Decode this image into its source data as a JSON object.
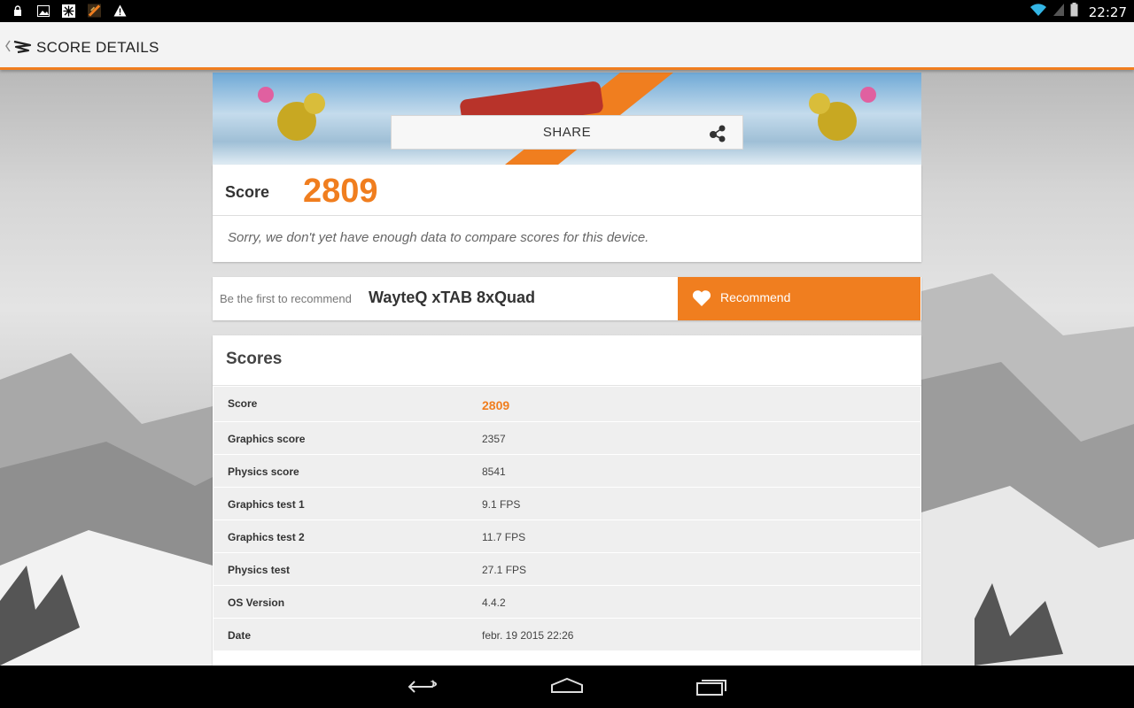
{
  "status_bar": {
    "time": "22:27",
    "left_icons": [
      "lock-icon",
      "gallery-icon",
      "snowflake-icon",
      "game-notification-icon",
      "warning-icon"
    ],
    "right_icons": [
      "wifi-icon",
      "signal-icon",
      "battery-icon"
    ]
  },
  "action_bar": {
    "title": "SCORE DETAILS"
  },
  "banner": {
    "share_label": "SHARE"
  },
  "score_card": {
    "label": "Score",
    "value": "2809",
    "note": "Sorry, we don't yet have enough data to compare scores for this device."
  },
  "recommend": {
    "prefix": "Be the first to recommend",
    "device": "WayteQ xTAB 8xQuad",
    "button_label": "Recommend"
  },
  "scores": {
    "title": "Scores",
    "rows": [
      {
        "name": "Score",
        "value": "2809"
      },
      {
        "name": "Graphics score",
        "value": "2357"
      },
      {
        "name": "Physics score",
        "value": "8541"
      },
      {
        "name": "Graphics test 1",
        "value": "9.1 FPS"
      },
      {
        "name": "Graphics test 2",
        "value": "11.7 FPS"
      },
      {
        "name": "Physics test",
        "value": "27.1 FPS"
      },
      {
        "name": "OS Version",
        "value": "4.4.2"
      },
      {
        "name": "Date",
        "value": "febr. 19 2015 22:26"
      }
    ]
  },
  "colors": {
    "accent": "#f07e1f",
    "row_bg": "#efefef"
  }
}
